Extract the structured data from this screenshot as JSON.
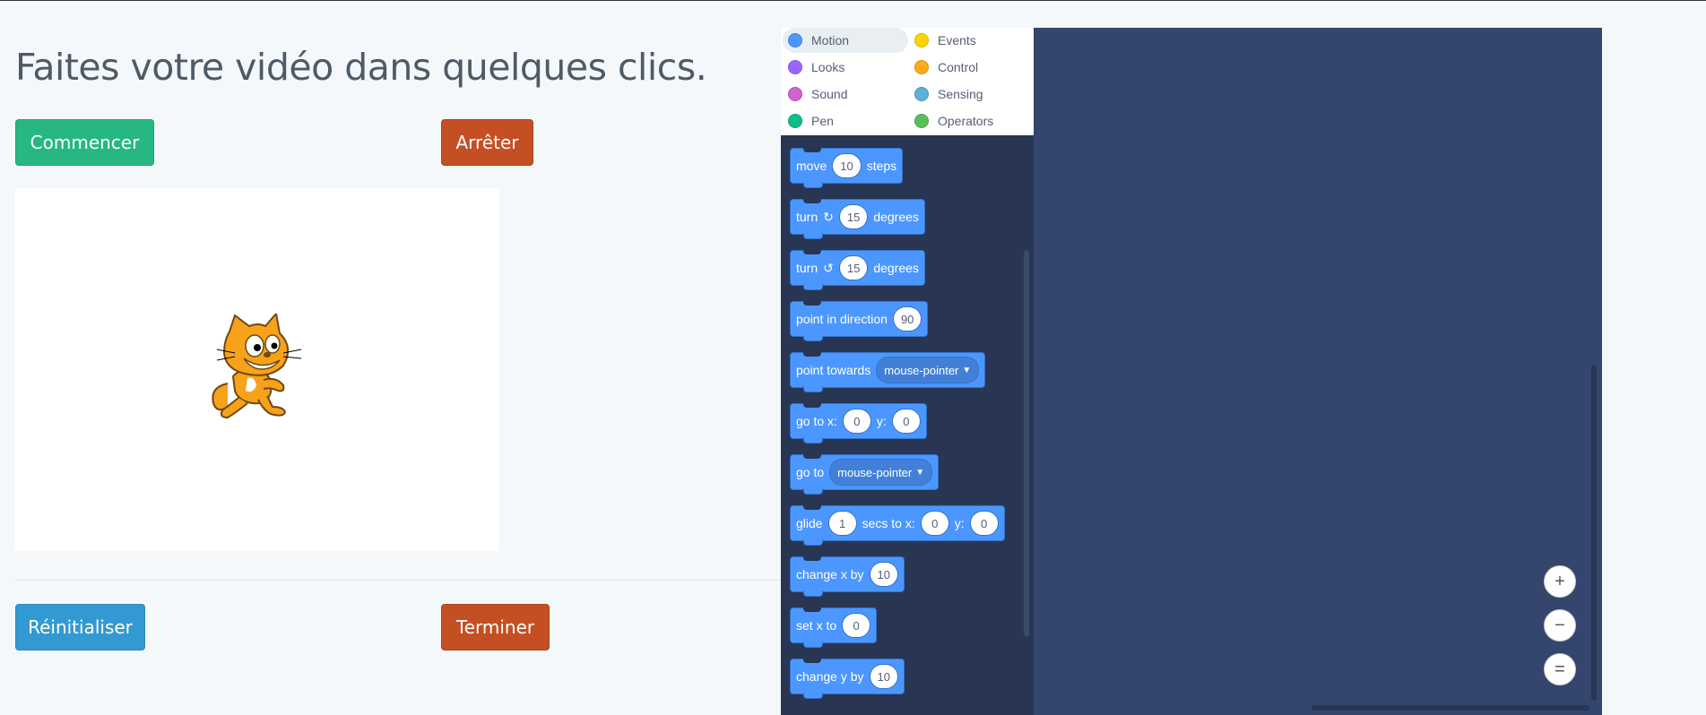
{
  "page": {
    "heading": "Faites votre vidéo dans quelques clics.",
    "buttons": {
      "start": "Commencer",
      "stop": "Arrêter",
      "reset": "Réinitialiser",
      "finish": "Terminer"
    }
  },
  "scratch": {
    "categories": [
      {
        "label": "Motion",
        "color": "#4c97ff"
      },
      {
        "label": "Events",
        "color": "#ffd500"
      },
      {
        "label": "Looks",
        "color": "#9966ff"
      },
      {
        "label": "Control",
        "color": "#ffab19"
      },
      {
        "label": "Sound",
        "color": "#cf63cf"
      },
      {
        "label": "Sensing",
        "color": "#5cb1d6"
      },
      {
        "label": "Pen",
        "color": "#0fbd8c"
      },
      {
        "label": "Operators",
        "color": "#59c059"
      }
    ],
    "blocks": {
      "move": {
        "pre": "move",
        "v1": "10",
        "post": "steps"
      },
      "turn_right": {
        "pre": "turn",
        "icon": "↻",
        "v1": "15",
        "post": "degrees"
      },
      "turn_left": {
        "pre": "turn",
        "icon": "↺",
        "v1": "15",
        "post": "degrees"
      },
      "point_direction": {
        "pre": "point in direction",
        "v1": "90"
      },
      "point_towards": {
        "pre": "point towards",
        "dd": "mouse-pointer"
      },
      "goto_xy": {
        "pre": "go to x:",
        "v1": "0",
        "mid": "y:",
        "v2": "0"
      },
      "goto": {
        "pre": "go to",
        "dd": "mouse-pointer"
      },
      "glide": {
        "pre": "glide",
        "v1": "1",
        "mid": "secs to x:",
        "v2": "0",
        "mid2": "y:",
        "v3": "0"
      },
      "change_x": {
        "pre": "change x by",
        "v1": "10"
      },
      "set_x": {
        "pre": "set x to",
        "v1": "0"
      },
      "change_y": {
        "pre": "change y by",
        "v1": "10"
      }
    },
    "zoom": {
      "in": "+",
      "out": "−",
      "reset": "="
    }
  }
}
